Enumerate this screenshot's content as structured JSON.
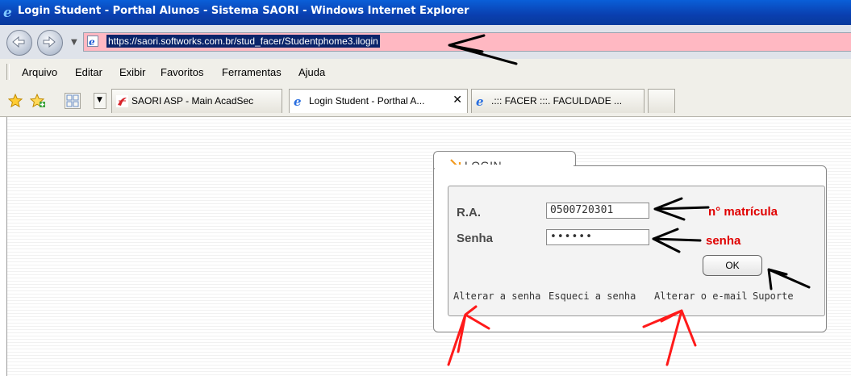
{
  "window": {
    "title": "Login Student - Porthal Alunos - Sistema SAORI - Windows Internet Explorer"
  },
  "addressbar": {
    "url": "https://saori.softworks.com.br/stud_facer/Studentphome3.ilogin"
  },
  "menu": {
    "items": [
      "Arquivo",
      "Editar",
      "Exibir",
      "Favoritos",
      "Ferramentas",
      "Ajuda"
    ]
  },
  "tabs": [
    {
      "label": "SAORI ASP - Main AcadSec",
      "active": false
    },
    {
      "label": "Login Student - Porthal A...",
      "active": true,
      "close": "✕"
    },
    {
      "label": ".::: FACER :::. FACULDADE ...",
      "active": false
    }
  ],
  "login": {
    "title": "LOGIN",
    "ra_label": "R.A.",
    "ra_value": "0500720301",
    "senha_label": "Senha",
    "senha_value": "••••••",
    "ok_label": "OK",
    "links": {
      "alterar_senha": "Alterar a senha",
      "esqueci_senha": "Esqueci a senha",
      "alterar_email": "Alterar o e-mail",
      "suporte": "Suporte"
    }
  },
  "annotations": {
    "ra_note": "n° matrícula",
    "senha_note": "senha",
    "color": "#e00000"
  },
  "icons": {
    "titlebar": "ie-icon",
    "nav_back": "back-arrow-icon",
    "nav_forward": "forward-arrow-icon",
    "favorites": "star-icon",
    "add_favorites": "add-favorites-icon",
    "quick_tabs": "quick-tabs-icon"
  }
}
